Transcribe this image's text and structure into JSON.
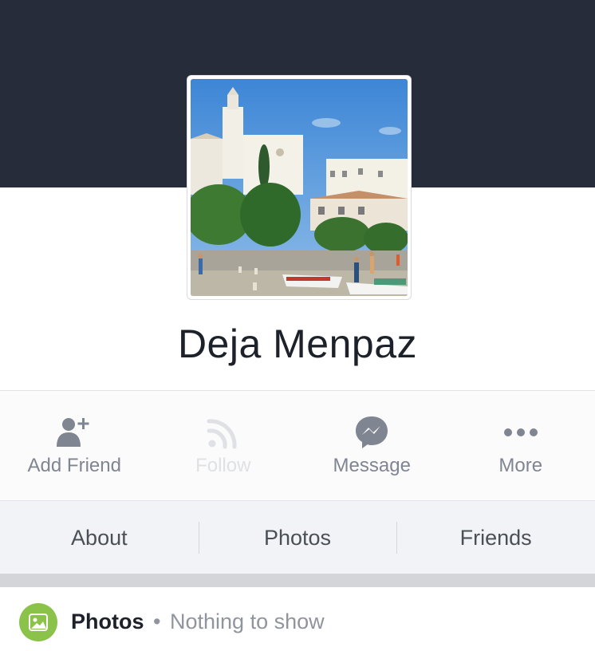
{
  "profile": {
    "name": "Deja Menpaz",
    "photo_description": "town-square-church-photo"
  },
  "actions": [
    {
      "label": "Add Friend",
      "icon": "add-friend-icon",
      "enabled": true
    },
    {
      "label": "Follow",
      "icon": "rss-follow-icon",
      "enabled": false
    },
    {
      "label": "Message",
      "icon": "messenger-icon",
      "enabled": true
    },
    {
      "label": "More",
      "icon": "more-dots-icon",
      "enabled": true
    }
  ],
  "tabs": [
    {
      "label": "About"
    },
    {
      "label": "Photos"
    },
    {
      "label": "Friends"
    }
  ],
  "photos_section": {
    "title": "Photos",
    "separator": "•",
    "status": "Nothing to show",
    "icon": "photo-icon"
  },
  "colors": {
    "cover": "#262c3a",
    "icon_gray": "#7f8591",
    "disabled": "#dfe1e5",
    "photos_green": "#8bc34a"
  }
}
